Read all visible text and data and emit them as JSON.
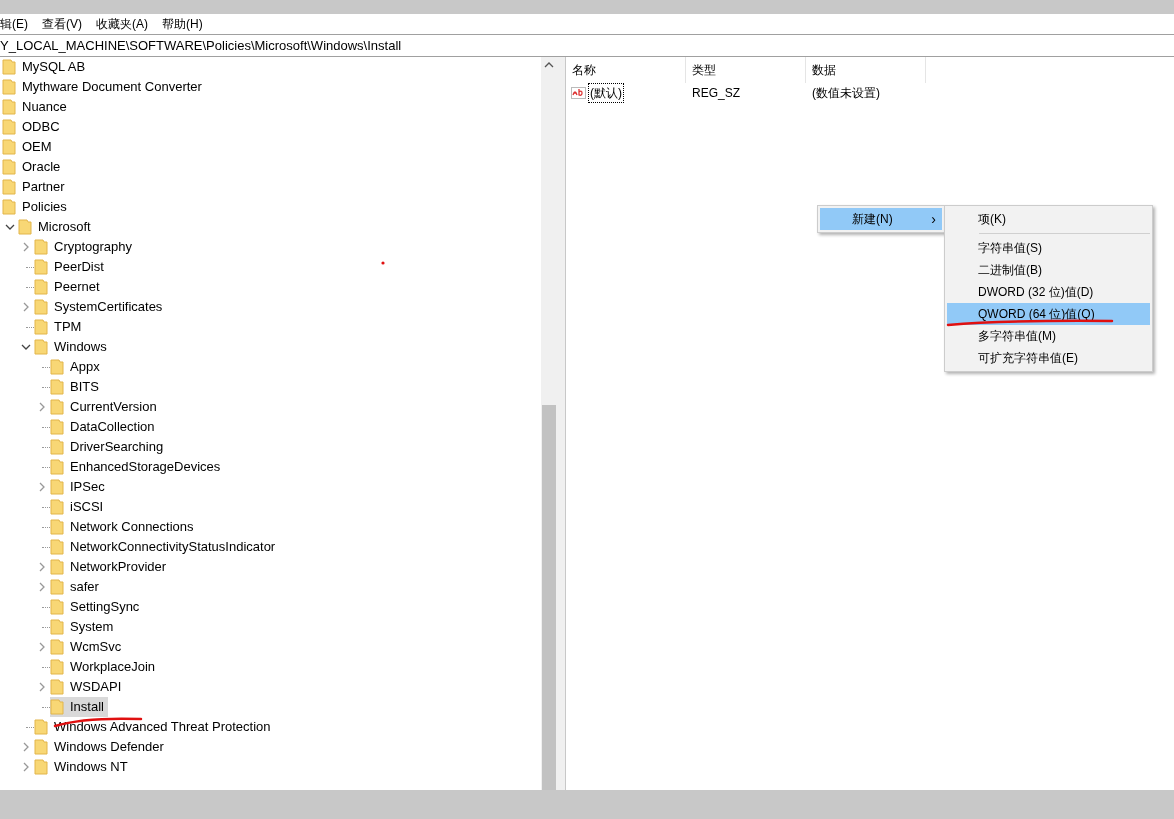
{
  "menu_bar": [
    {
      "label": "辑(E)"
    },
    {
      "label": "查看(V)"
    },
    {
      "label": "收藏夹(A)"
    },
    {
      "label": "帮助(H)"
    }
  ],
  "address_bar": {
    "path": "Y_LOCAL_MACHINE\\SOFTWARE\\Policies\\Microsoft\\Windows\\Install"
  },
  "tree": {
    "items": [
      {
        "label": "MySQL AB",
        "selected": false
      },
      {
        "label": "Mythware Document Converter",
        "selected": false
      },
      {
        "label": "Nuance",
        "selected": false
      },
      {
        "label": "ODBC",
        "selected": false
      },
      {
        "label": "OEM",
        "selected": false
      },
      {
        "label": "Oracle",
        "selected": false
      },
      {
        "label": "Partner",
        "selected": false
      },
      {
        "label": "Policies",
        "selected": false,
        "children": [
          {
            "label": "Microsoft",
            "selected": false,
            "expanded": true,
            "children": [
              {
                "label": "Cryptography",
                "selected": false,
                "expanded": false
              },
              {
                "label": "PeerDist",
                "selected": false
              },
              {
                "label": "Peernet",
                "selected": false
              },
              {
                "label": "SystemCertificates",
                "selected": false,
                "expanded": false
              },
              {
                "label": "TPM",
                "selected": false
              },
              {
                "label": "Windows",
                "selected": false,
                "expanded": true,
                "children": [
                  {
                    "label": "Appx",
                    "selected": false
                  },
                  {
                    "label": "BITS",
                    "selected": false
                  },
                  {
                    "label": "CurrentVersion",
                    "selected": false,
                    "expanded": false
                  },
                  {
                    "label": "DataCollection",
                    "selected": false
                  },
                  {
                    "label": "DriverSearching",
                    "selected": false
                  },
                  {
                    "label": "EnhancedStorageDevices",
                    "selected": false
                  },
                  {
                    "label": "IPSec",
                    "selected": false,
                    "expanded": false
                  },
                  {
                    "label": "iSCSI",
                    "selected": false
                  },
                  {
                    "label": "Network Connections",
                    "selected": false
                  },
                  {
                    "label": "NetworkConnectivityStatusIndicator",
                    "selected": false
                  },
                  {
                    "label": "NetworkProvider",
                    "selected": false,
                    "expanded": false
                  },
                  {
                    "label": "safer",
                    "selected": false,
                    "expanded": false
                  },
                  {
                    "label": "SettingSync",
                    "selected": false
                  },
                  {
                    "label": "System",
                    "selected": false
                  },
                  {
                    "label": "WcmSvc",
                    "selected": false,
                    "expanded": false
                  },
                  {
                    "label": "WorkplaceJoin",
                    "selected": false
                  },
                  {
                    "label": "WSDAPI",
                    "selected": false,
                    "expanded": false
                  },
                  {
                    "label": "Install",
                    "selected": true
                  }
                ]
              },
              {
                "label": "Windows Advanced Threat Protection",
                "selected": false
              },
              {
                "label": "Windows Defender",
                "selected": false,
                "expanded": false
              },
              {
                "label": "Windows NT",
                "selected": false,
                "expanded": false
              }
            ]
          }
        ]
      }
    ]
  },
  "values_list": {
    "columns": [
      "名称",
      "类型",
      "数据"
    ],
    "rows": [
      {
        "name": "(默认)",
        "type": "REG_SZ",
        "data": "(数值未设置)",
        "focused": true
      }
    ]
  },
  "context_menu": {
    "items": [
      {
        "label": "新建(N)",
        "arrow": "›",
        "selected": true
      }
    ],
    "submenu": [
      {
        "kind": "item",
        "label": "项(K)",
        "selected": false
      },
      {
        "kind": "separator"
      },
      {
        "kind": "item",
        "label": "字符串值(S)",
        "selected": false
      },
      {
        "kind": "item",
        "label": "二进制值(B)",
        "selected": false
      },
      {
        "kind": "item",
        "label": "DWORD (32 位)值(D)",
        "selected": false
      },
      {
        "kind": "item",
        "label": "QWORD (64 位)值(Q)",
        "selected": true
      },
      {
        "kind": "item",
        "label": "多字符串值(M)",
        "selected": false
      },
      {
        "kind": "item",
        "label": "可扩充字符串值(E)",
        "selected": false
      }
    ]
  }
}
